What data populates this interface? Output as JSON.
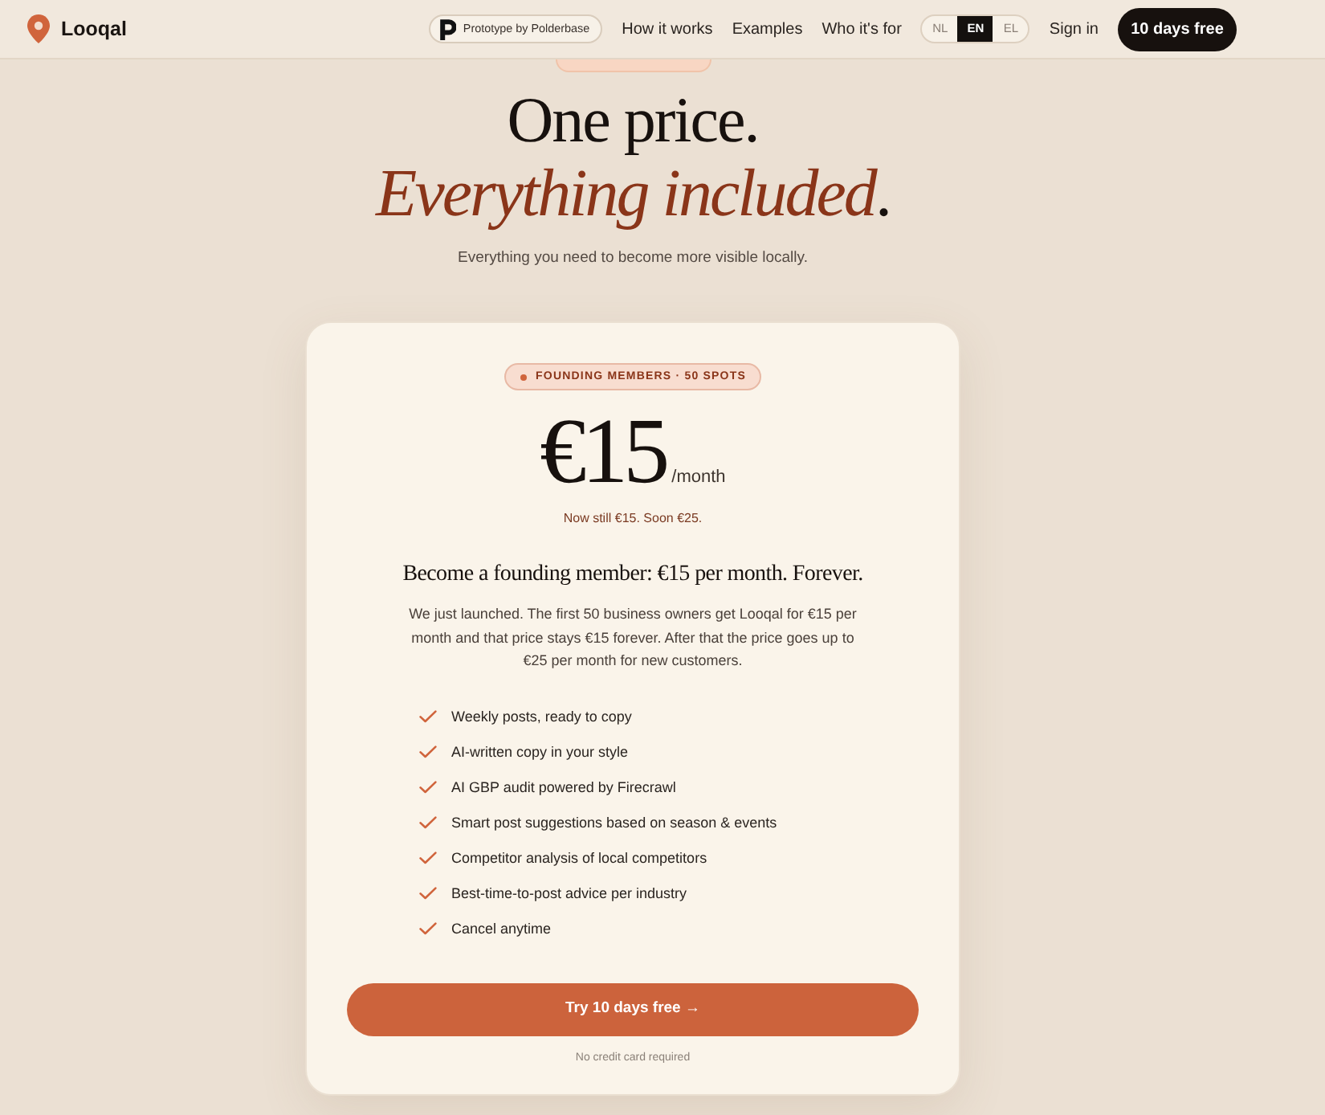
{
  "header": {
    "brand": "Looqal",
    "prototype_badge": "Prototype by Polderbase",
    "nav": [
      "How it works",
      "Examples",
      "Who it's for"
    ],
    "languages": [
      {
        "label": "NL",
        "selected": false
      },
      {
        "label": "EN",
        "selected": true
      },
      {
        "label": "EL",
        "selected": false
      }
    ],
    "sign_in": "Sign in",
    "cta": "10 days free"
  },
  "hero": {
    "title_line1": "One price.",
    "title_line2": "Everything included",
    "title_end": ".",
    "subtitle": "Everything you need to become more visible locally."
  },
  "card": {
    "badge": "FOUNDING MEMBERS · 50 SPOTS",
    "price": "€15",
    "period": "/month",
    "price_note": "Now still €15. Soon €25.",
    "heading": "Become a founding member: €15 per month. Forever.",
    "description": "We just launched. The first 50 business owners get Looqal for €15 per month and that price stays €15 forever. After that the price goes up to €25 per month for new customers.",
    "features": [
      "Weekly posts, ready to copy",
      "AI-written copy in your style",
      "AI GBP audit powered by Firecrawl",
      "Smart post suggestions based on season & events",
      "Competitor analysis of local competitors",
      "Best-time-to-post advice per industry",
      "Cancel anytime"
    ],
    "button": "Try 10 days free →",
    "footnote": "No credit card required"
  }
}
